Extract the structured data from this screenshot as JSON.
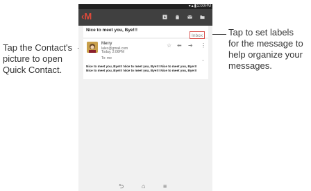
{
  "callouts": {
    "left_lines": [
      "Tap the Contact's",
      "picture to open",
      "Quick Contact."
    ],
    "right_lines": [
      "Tap to set labels",
      "for the message to",
      "help organize your",
      "messages."
    ]
  },
  "status_bar": {
    "time": "1:00PM",
    "icons": "wifi-icon signal-icon battery-icon"
  },
  "app_bar": {
    "logo_icon": "gmail-logo-icon",
    "back_glyph": "‹",
    "logo_glyph": "M",
    "actions": [
      "archive-icon",
      "delete-icon",
      "mark-unread-icon",
      "move-to-folder-icon"
    ]
  },
  "conversation": {
    "subject": "Nice to meet you, Bye!!!",
    "label": "Inbox"
  },
  "message": {
    "sender": "Merry",
    "email": "lalec@gmail.com",
    "date": "Today, 2:06PM",
    "to": "To: me",
    "action_icons": [
      "star-icon",
      "reply-icon",
      "forward-icon",
      "overflow-menu-icon"
    ],
    "body_lines": [
      "Nice to meet you, Bye!!! Nice to meet you, Bye!!! Nice to meet you, Bye!!!",
      "Nice to meet you, Bye!!! Nice to meet you, Bye!!! Nice to meet you, Bye!!!"
    ]
  },
  "nav_bar": {
    "icons": [
      "back-icon",
      "home-icon",
      "recents-icon"
    ]
  },
  "colors": {
    "app_bar": "#404040",
    "accent": "#e04a3b",
    "label_border": "#d9534f",
    "screen_bg": "#f1f1f1"
  }
}
